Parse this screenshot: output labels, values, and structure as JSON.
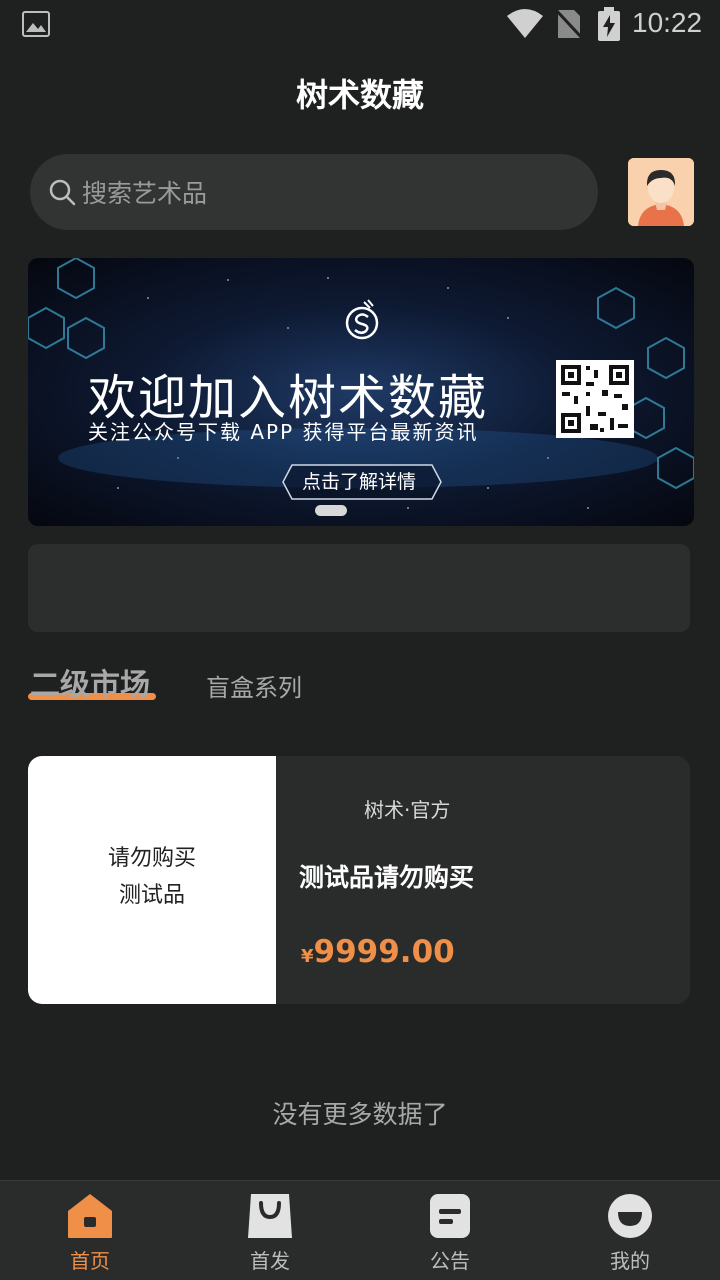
{
  "status_bar": {
    "time": "10:22"
  },
  "header": {
    "title": "树术数藏"
  },
  "search": {
    "placeholder": "搜索艺术品"
  },
  "banner": {
    "headline": "欢迎加入树术数藏",
    "subline": "关注公众号下载 APP 获得平台最新资讯",
    "cta_label": "点击了解详情"
  },
  "tabs": [
    {
      "label": "二级市场",
      "active": true
    },
    {
      "label": "盲盒系列",
      "active": false
    }
  ],
  "products": [
    {
      "image_text": [
        "请勿购买",
        "测试品"
      ],
      "creator": "树术·官方",
      "name": "测试品请勿购买",
      "currency": "¥",
      "price": "9999.00"
    }
  ],
  "list_end_text": "没有更多数据了",
  "bottom_nav": [
    {
      "label": "首页",
      "icon": "home-icon",
      "active": true
    },
    {
      "label": "首发",
      "icon": "shopping-bag-icon",
      "active": false
    },
    {
      "label": "公告",
      "icon": "notice-icon",
      "active": false
    },
    {
      "label": "我的",
      "icon": "profile-icon",
      "active": false
    }
  ],
  "colors": {
    "accent": "#f08f48",
    "background": "#1f2020",
    "card": "#2a2b2b"
  }
}
